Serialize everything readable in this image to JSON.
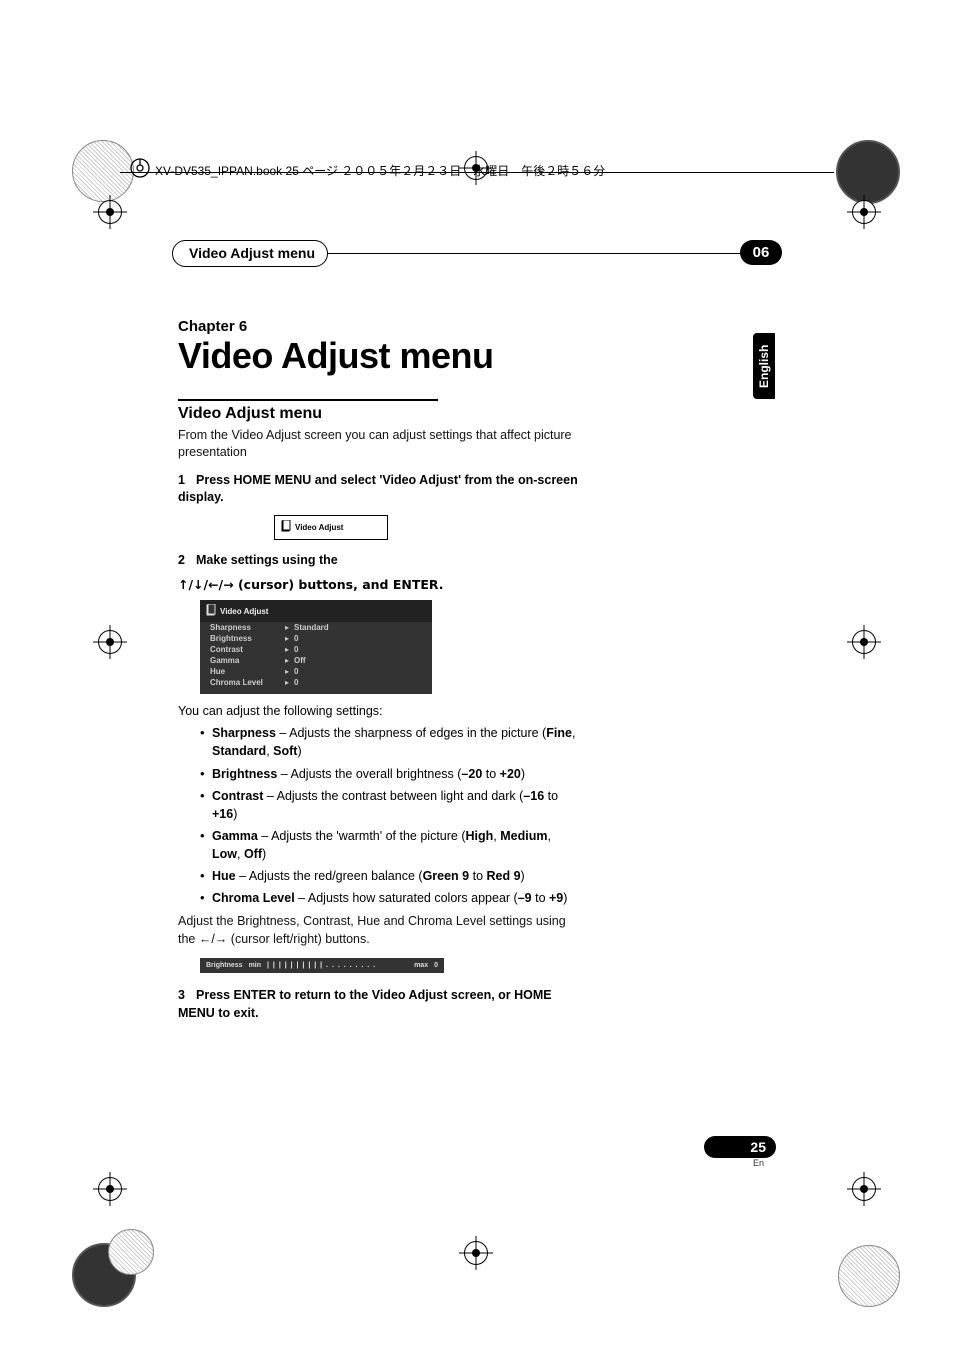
{
  "meta": {
    "book_header": "XV-DV535_IPPAN.book 25 ページ ２００５年２月２３日　水曜日　午後２時５６分"
  },
  "tabs": {
    "section_title": "Video Adjust menu",
    "chapter_number": "06",
    "side_label": "English"
  },
  "chapter": {
    "label": "Chapter 6",
    "title": "Video Adjust menu"
  },
  "section": {
    "heading": "Video Adjust menu",
    "intro": "From the Video Adjust screen you can adjust settings that affect picture presentation"
  },
  "steps": {
    "s1_num": "1",
    "s1_text": "Press HOME MENU and select 'Video Adjust' from the on-screen display.",
    "s2_num": "2",
    "s2_text_a": "Make settings using the",
    "s2_text_b": "↑/↓/←/→ (cursor) buttons, and ENTER.",
    "s3_num": "3",
    "s3_text": "Press ENTER to return to the Video Adjust screen, or HOME MENU to exit."
  },
  "ui_small": {
    "label": "Video Adjust"
  },
  "menu": {
    "title": "Video Adjust",
    "rows": [
      {
        "label": "Sharpness",
        "value": "Standard"
      },
      {
        "label": "Brightness",
        "value": "0"
      },
      {
        "label": "Contrast",
        "value": "0"
      },
      {
        "label": "Gamma",
        "value": "Off"
      },
      {
        "label": "Hue",
        "value": "0"
      },
      {
        "label": "Chroma Level",
        "value": "0"
      }
    ]
  },
  "settings_intro": "You can adjust the following settings:",
  "bullets": {
    "sharpness_a": "Sharpness",
    "sharpness_b": " – Adjusts the sharpness of edges in the picture (",
    "sharpness_c": "Fine",
    "sharpness_d": ", ",
    "sharpness_e": "Standard",
    "sharpness_f": ", ",
    "sharpness_g": "Soft",
    "sharpness_h": ")",
    "brightness_a": "Brightness",
    "brightness_b": " – Adjusts the overall brightness (",
    "brightness_c": "–20",
    "brightness_d": " to ",
    "brightness_e": "+20",
    "brightness_f": ")",
    "contrast_a": "Contrast",
    "contrast_b": " – Adjusts the contrast between light and dark (",
    "contrast_c": "–16",
    "contrast_d": " to ",
    "contrast_e": "+16",
    "contrast_f": ")",
    "gamma_a": "Gamma",
    "gamma_b": " – Adjusts the 'warmth' of the picture (",
    "gamma_c": "High",
    "gamma_d": ", ",
    "gamma_e": "Medium",
    "gamma_f": ", ",
    "gamma_g": "Low",
    "gamma_h": ", ",
    "gamma_i": "Off",
    "gamma_j": ")",
    "hue_a": "Hue",
    "hue_b": " – Adjusts the red/green balance (",
    "hue_c": "Green 9",
    "hue_d": " to ",
    "hue_e": "Red 9",
    "hue_f": ")",
    "chroma_a": "Chroma Level",
    "chroma_b": " – Adjusts how saturated colors appear (",
    "chroma_c": "–9",
    "chroma_d": " to ",
    "chroma_e": "+9",
    "chroma_f": ")"
  },
  "post_bullets": "Adjust the Brightness, Contrast, Hue and Chroma Level settings using the ←/→ (cursor left/right) buttons.",
  "slider": {
    "label": "Brightness",
    "min": "min",
    "track": "| | | | | | | | | | . . . . . . . . .",
    "max": "max",
    "value": "0"
  },
  "footer": {
    "page": "25",
    "lang": "En"
  }
}
